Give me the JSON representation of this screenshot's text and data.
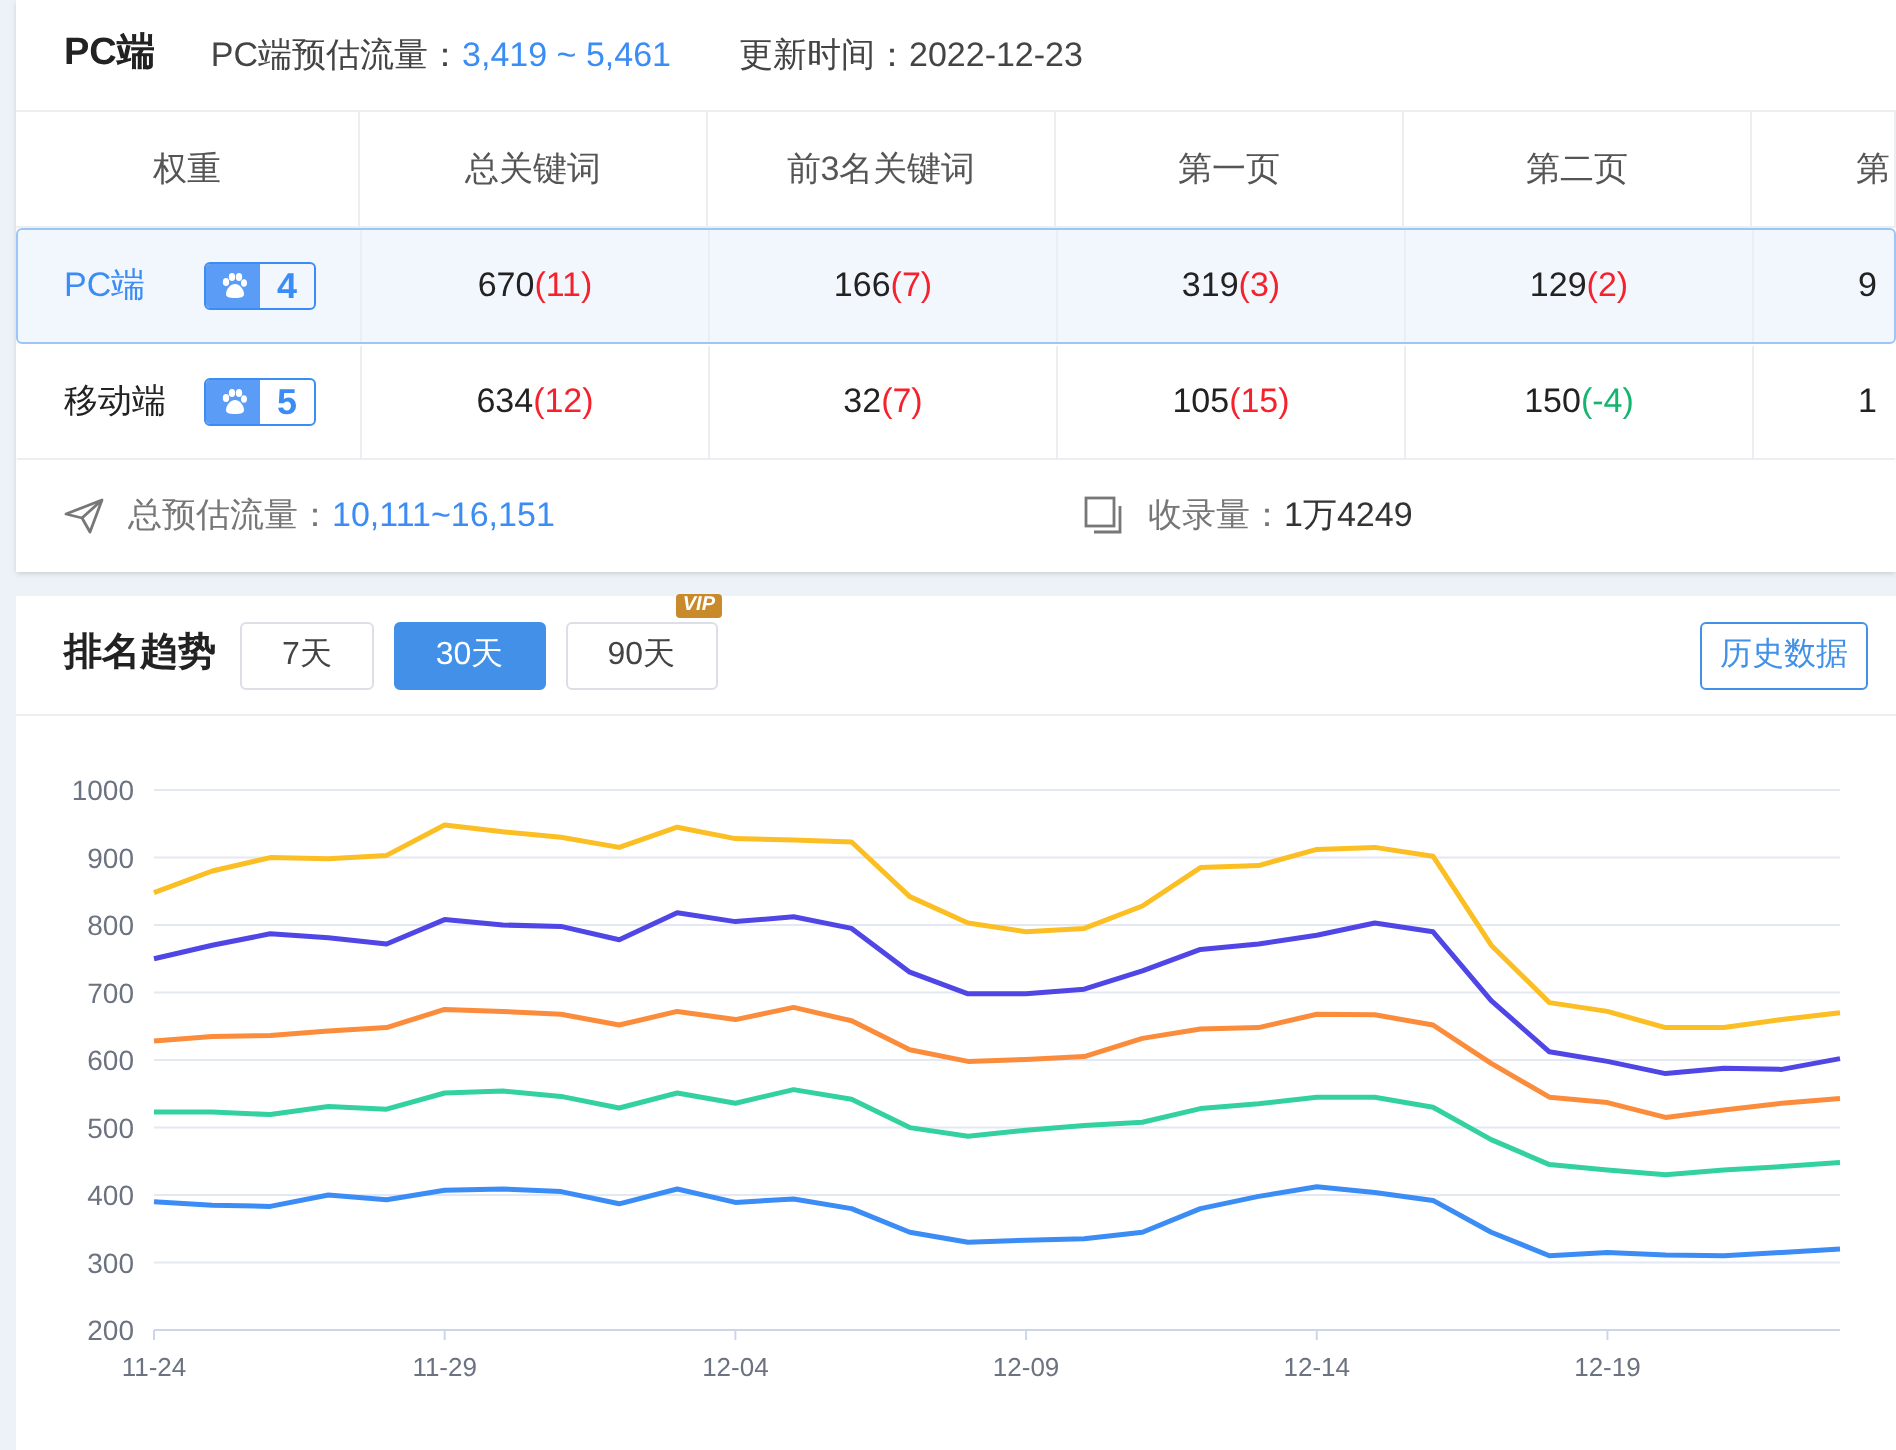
{
  "header": {
    "title": "PC端",
    "traffic_label": "PC端预估流量：",
    "traffic_value": "3,419 ~ 5,461",
    "update_label": "更新时间：",
    "update_value": "2022-12-23"
  },
  "table": {
    "columns": [
      "权重",
      "总关键词",
      "前3名关键词",
      "第一页",
      "第二页",
      "第"
    ],
    "rows": [
      {
        "selected": true,
        "cells": [
          {
            "kind": "platform",
            "label": "PC端",
            "weight": "4"
          },
          {
            "kind": "count",
            "value": "670",
            "change": "(11)",
            "color": "#f5222d"
          },
          {
            "kind": "count",
            "value": "166",
            "change": "(7)",
            "color": "#f5222d"
          },
          {
            "kind": "count",
            "value": "319",
            "change": "(3)",
            "color": "#f5222d"
          },
          {
            "kind": "count",
            "value": "129",
            "change": "(2)",
            "color": "#f5222d"
          },
          {
            "kind": "count",
            "value": "9"
          }
        ]
      },
      {
        "selected": false,
        "cells": [
          {
            "kind": "platform",
            "label": "移动端",
            "weight": "5"
          },
          {
            "kind": "count",
            "value": "634",
            "change": "(12)",
            "color": "#f5222d"
          },
          {
            "kind": "count",
            "value": "32",
            "change": "(7)",
            "color": "#f5222d"
          },
          {
            "kind": "count",
            "value": "105",
            "change": "(15)",
            "color": "#f5222d"
          },
          {
            "kind": "count",
            "value": "150",
            "change": "(-4)",
            "color": "#13b56f"
          },
          {
            "kind": "count",
            "value": "1"
          }
        ]
      }
    ]
  },
  "summary": {
    "traffic_label": "总预估流量：",
    "traffic_value": "10,111~16,151",
    "indexed_label": "收录量：",
    "indexed_value": "1万4249"
  },
  "trend": {
    "title": "排名趋势",
    "ranges": [
      {
        "label": "7天",
        "selected": false
      },
      {
        "label": "30天",
        "selected": true
      },
      {
        "label": "90天",
        "selected": false,
        "badge": "VIP"
      }
    ],
    "history_button": "历史数据",
    "chart_data": {
      "type": "line",
      "grid": true,
      "categories": [
        "11-24",
        null,
        null,
        null,
        null,
        "11-29",
        null,
        null,
        null,
        null,
        "12-04",
        null,
        null,
        null,
        null,
        "12-09",
        null,
        null,
        null,
        null,
        "12-14",
        null,
        null,
        null,
        null,
        "12-19",
        null,
        null,
        null,
        null
      ],
      "ylim": [
        200,
        1000
      ],
      "yticks": [
        200,
        300,
        400,
        500,
        600,
        700,
        800,
        900,
        1000
      ],
      "series": [
        {
          "color": "#fbbf24",
          "values": [
            848,
            880,
            900,
            898,
            903,
            948,
            938,
            930,
            915,
            945,
            928,
            926,
            923,
            842,
            803,
            790,
            795,
            828,
            885,
            888,
            912,
            915,
            902,
            770,
            685,
            672,
            648,
            648,
            660,
            670
          ]
        },
        {
          "color": "#4f46e5",
          "values": [
            750,
            770,
            787,
            781,
            772,
            808,
            800,
            798,
            778,
            818,
            805,
            812,
            795,
            730,
            698,
            698,
            705,
            732,
            764,
            772,
            785,
            803,
            790,
            688,
            612,
            598,
            580,
            588,
            586,
            602
          ]
        },
        {
          "color": "#fb8c3c",
          "values": [
            628,
            635,
            636,
            643,
            648,
            675,
            672,
            668,
            652,
            672,
            660,
            678,
            658,
            615,
            598,
            601,
            605,
            632,
            646,
            648,
            668,
            667,
            652,
            595,
            545,
            537,
            515,
            526,
            536,
            543
          ]
        },
        {
          "color": "#34d1a0",
          "values": [
            523,
            523,
            519,
            531,
            527,
            551,
            554,
            546,
            529,
            551,
            536,
            556,
            542,
            500,
            487,
            496,
            503,
            508,
            528,
            535,
            545,
            545,
            530,
            482,
            445,
            437,
            430,
            437,
            442,
            448
          ]
        },
        {
          "color": "#3b8cf5",
          "values": [
            390,
            385,
            383,
            400,
            393,
            407,
            409,
            405,
            387,
            409,
            389,
            394,
            380,
            345,
            330,
            333,
            335,
            345,
            380,
            398,
            412,
            404,
            392,
            345,
            310,
            315,
            311,
            310,
            315,
            320
          ]
        }
      ]
    }
  }
}
